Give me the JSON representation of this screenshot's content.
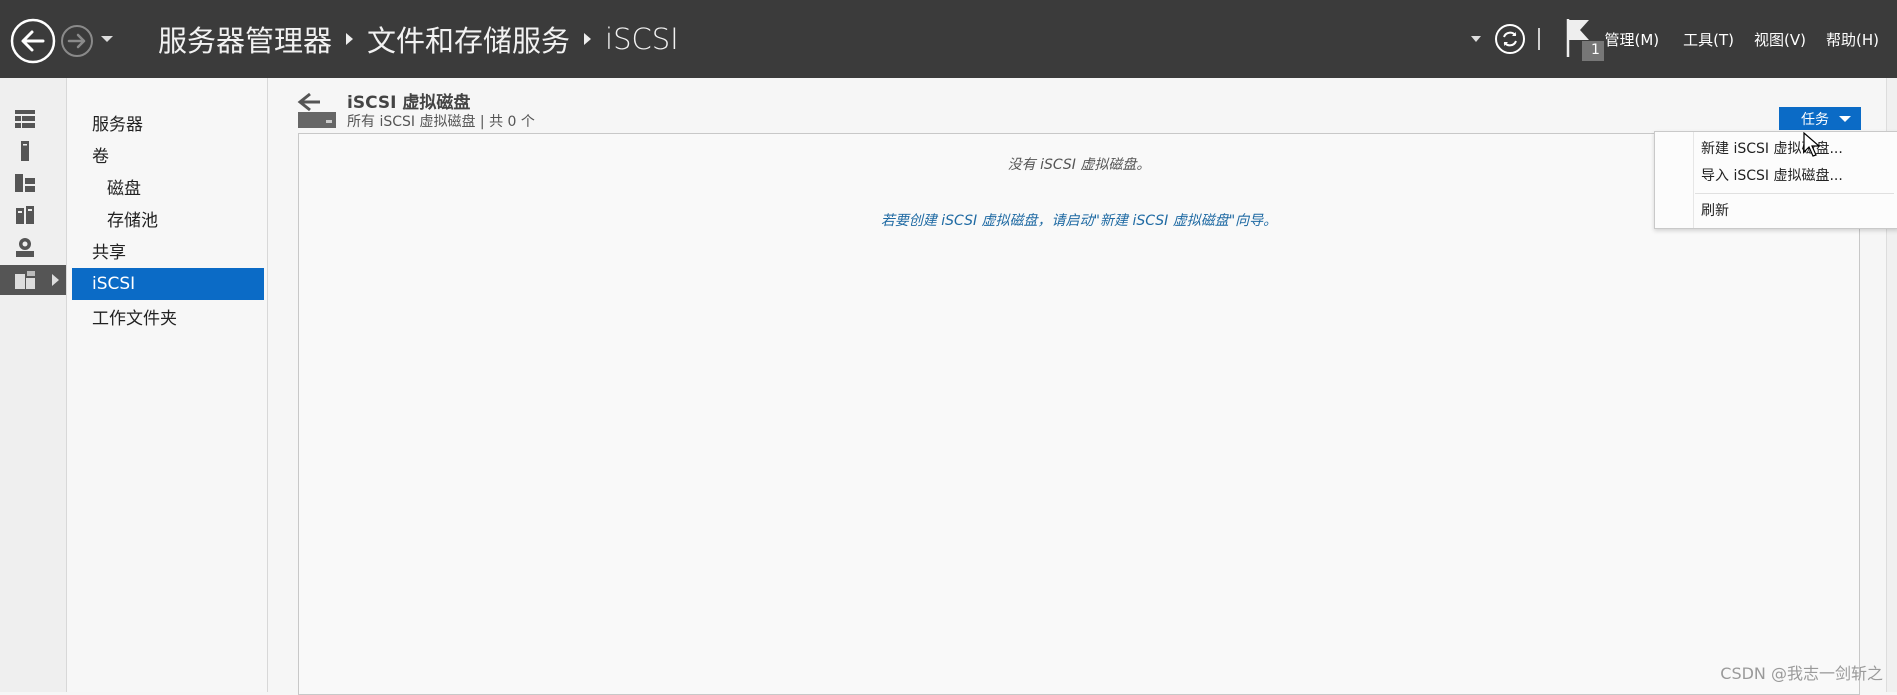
{
  "header": {
    "breadcrumb": [
      "服务器管理器",
      "文件和存储服务",
      "iSCSI"
    ],
    "menus": [
      "管理(M)",
      "工具(T)",
      "视图(V)",
      "帮助(H)"
    ],
    "notification_count": "1"
  },
  "rail": {
    "icons": [
      "dashboard-icon",
      "local-server-icon",
      "all-servers-icon",
      "file-services-icon",
      "iis-icon",
      "file-storage-icon"
    ]
  },
  "tree": {
    "items": [
      {
        "label": "服务器",
        "level": 1
      },
      {
        "label": "卷",
        "level": 1
      },
      {
        "label": "磁盘",
        "level": 2
      },
      {
        "label": "存储池",
        "level": 2
      },
      {
        "label": "共享",
        "level": 1
      },
      {
        "label": "iSCSI",
        "level": 1,
        "selected": true
      },
      {
        "label": "工作文件夹",
        "level": 1
      }
    ]
  },
  "main": {
    "title": "iSCSI 虚拟磁盘",
    "subtitle": "所有 iSCSI 虚拟磁盘 | 共 0 个",
    "tasks_label": "任务",
    "empty_message": "没有 iSCSI 虚拟磁盘。",
    "hint_message": "若要创建 iSCSI 虚拟磁盘，请启动\"新建 iSCSI 虚拟磁盘\"向导。"
  },
  "tasks_menu": {
    "items": [
      "新建 iSCSI 虚拟磁盘...",
      "导入 iSCSI 虚拟磁盘...",
      "刷新"
    ]
  },
  "watermark": "CSDN @我志一剑斩之",
  "colors": {
    "topbar": "#3b3b3b",
    "accent": "#0b6bc6",
    "hint_text": "#1f6aa3"
  }
}
